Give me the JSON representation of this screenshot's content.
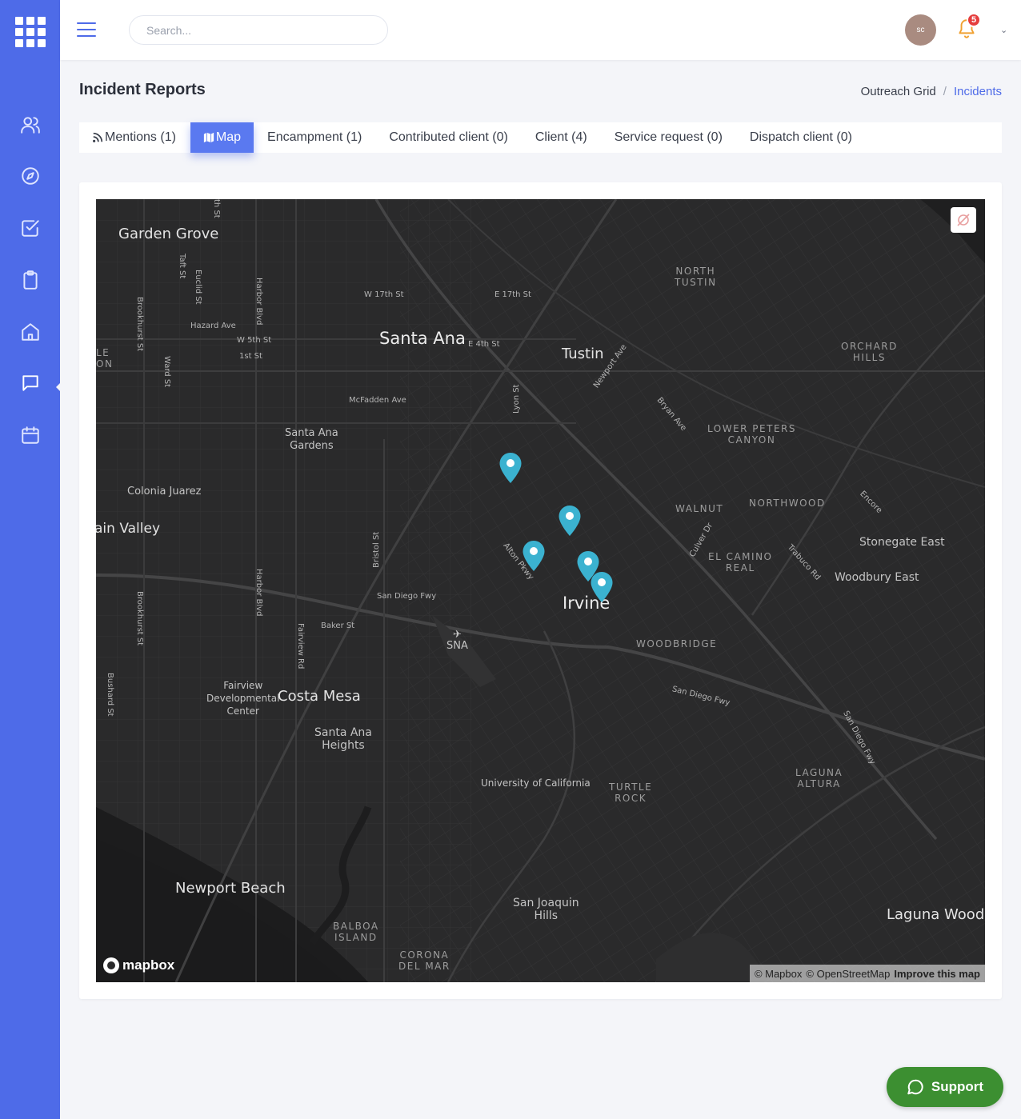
{
  "topbar": {
    "search_placeholder": "Search...",
    "avatar_initials": "sc",
    "notification_count": "5"
  },
  "page": {
    "title": "Incident Reports",
    "breadcrumb": {
      "root": "Outreach Grid",
      "separator": "/",
      "current": "Incidents"
    }
  },
  "tabs": [
    {
      "label": "Mentions (1)",
      "icon": "rss-icon"
    },
    {
      "label": "Map",
      "icon": "map-icon",
      "active": true
    },
    {
      "label": "Encampment (1)"
    },
    {
      "label": "Contributed client (0)"
    },
    {
      "label": "Client (4)"
    },
    {
      "label": "Service request (0)"
    },
    {
      "label": "Dispatch client (0)"
    }
  ],
  "sidebar": {
    "items": [
      {
        "icon": "users-icon"
      },
      {
        "icon": "compass-icon"
      },
      {
        "icon": "checkbox-icon"
      },
      {
        "icon": "clipboard-icon"
      },
      {
        "icon": "home-icon"
      },
      {
        "icon": "chat-icon",
        "active": true
      },
      {
        "icon": "calendar-icon"
      }
    ]
  },
  "map": {
    "labels": {
      "garden_grove": "Garden Grove",
      "santa_ana": "Santa Ana",
      "tustin": "Tustin",
      "irvine": "Irvine",
      "costa_mesa": "Costa Mesa",
      "newport_beach": "Newport Beach",
      "laguna_woods": "Laguna Woods",
      "fountain_valley": "ain Valley",
      "colonia_juarez": "Colonia Juarez",
      "santa_ana_gardens_1": "Santa Ana",
      "santa_ana_gardens_2": "Gardens",
      "santa_ana_heights_1": "Santa Ana",
      "santa_ana_heights_2": "Heights",
      "fairview_1": "Fairview",
      "fairview_2": "Developmental",
      "fairview_3": "Center",
      "uc": "University of California",
      "san_joaquin_1": "San Joaquin",
      "san_joaquin_2": "Hills",
      "stonegate": "Stonegate East",
      "woodbury": "Woodbury East",
      "north_tustin_1": "NORTH",
      "north_tustin_2": "TUSTIN",
      "orchard_1": "ORCHARD",
      "orchard_2": "HILLS",
      "lower_peters_1": "LOWER PETERS",
      "lower_peters_2": "CANYON",
      "walnut": "WALNUT",
      "northwood": "NORTHWOOD",
      "el_camino_1": "EL CAMINO",
      "el_camino_2": "REAL",
      "woodbridge": "WOODBRIDGE",
      "turtle_1": "TURTLE",
      "turtle_2": "ROCK",
      "laguna_altura_1": "LAGUNA",
      "laguna_altura_2": "ALTURA",
      "balboa_1": "BALBOA",
      "balboa_2": "ISLAND",
      "corona_1": "CORONA",
      "corona_2": "DEL MAR",
      "le_on_1": "LE",
      "le_on_2": "ON",
      "sna": "SNA",
      "w17": "W 17th St",
      "e17": "E 17th St",
      "e4": "E 4th St",
      "hazard": "Hazard Ave",
      "w5": "W 5th St",
      "first": "1st St",
      "mcfadden": "McFadden Ave",
      "sd_fwy_1": "San Diego Fwy",
      "sd_fwy_2": "San Diego Fwy",
      "sd_fwy_3": "San Diego Fwy",
      "baker": "Baker St",
      "taft": "Taft St",
      "euclid": "Euclid St",
      "harbor_1": "Harbor Blvd",
      "harbor_2": "Harbor Blvd",
      "brookhurst_1": "Brookhurst St",
      "brookhurst_2": "Brookhurst St",
      "ward": "Ward St",
      "bushard": "Bushard St",
      "fairview_rd": "Fairview Rd",
      "bristol": "Bristol St",
      "lyon": "Lyon St",
      "newport_ave": "Newport Ave",
      "bryan": "Bryan Ave",
      "alton": "Alton Pkwy",
      "culver": "Culver Dr",
      "trabuco": "Trabuco Rd",
      "encore": "Encore",
      "th_st": "th St"
    },
    "pin_color": "#3bb2d0",
    "logo_text": "mapbox",
    "attribution": {
      "mapbox": "© Mapbox",
      "osm": "© OpenStreetMap",
      "improve": "Improve this map"
    }
  },
  "support": {
    "label": "Support"
  },
  "colors": {
    "sidebar": "#4e6be8",
    "accent": "#5a79f0",
    "support_button": "#3c8f31",
    "map_background": "#2a2a2b",
    "badge": "#e53d3d"
  }
}
